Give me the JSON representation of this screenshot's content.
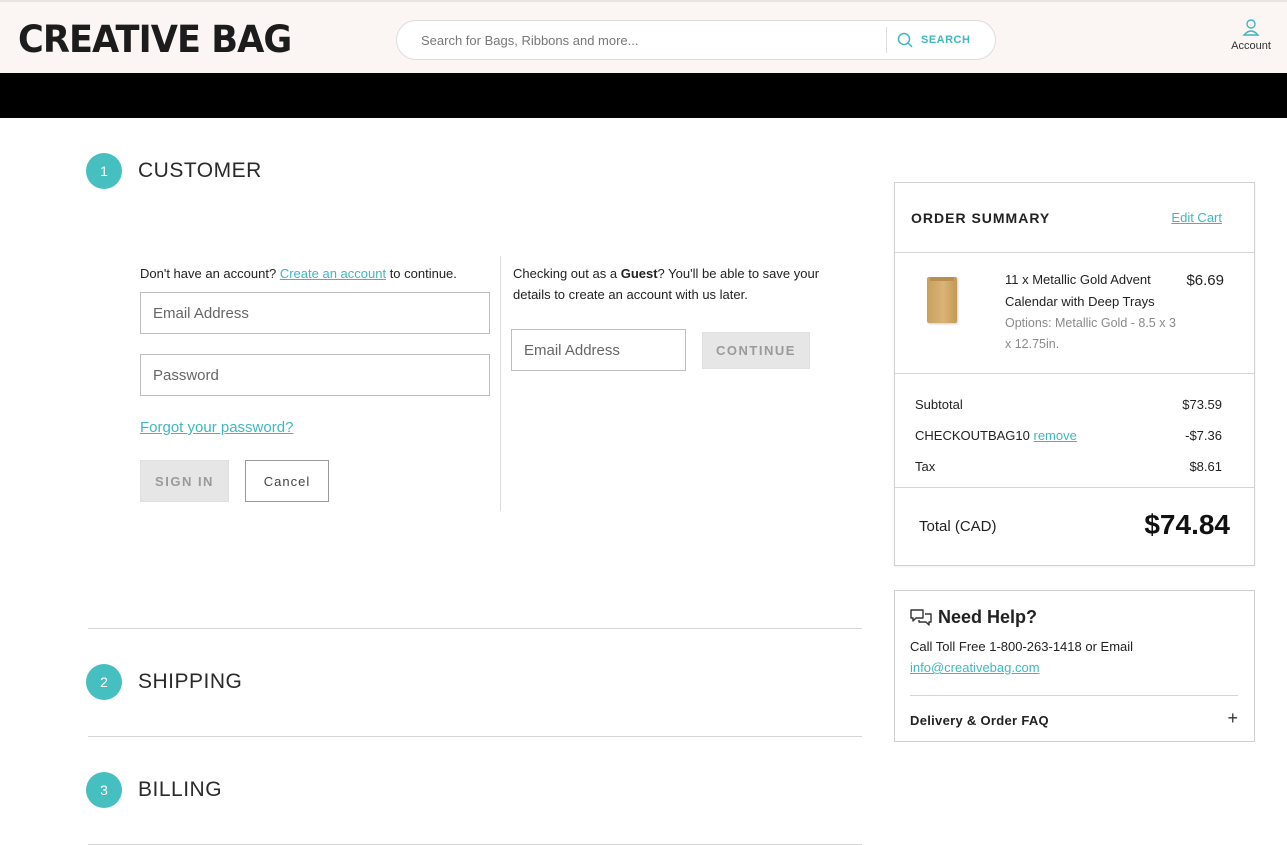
{
  "header": {
    "logo": "CREATIVE BAG",
    "search_placeholder": "Search for Bags, Ribbons and more...",
    "search_button": "SEARCH",
    "account_label": "Account"
  },
  "steps": {
    "customer": {
      "number": "1",
      "title": "CUSTOMER"
    },
    "shipping": {
      "number": "2",
      "title": "SHIPPING"
    },
    "billing": {
      "number": "3",
      "title": "BILLING"
    }
  },
  "login": {
    "prompt_pre": "Don't have an account?",
    "create_link": "Create an account",
    "prompt_post": "to continue.",
    "email_placeholder": "Email Address",
    "password_placeholder": "Password",
    "forgot_link": "Forgot your password?",
    "signin_button": "SIGN IN",
    "cancel_button": "Cancel"
  },
  "guest": {
    "text_pre": "Checking out as a",
    "text_bold": "Guest",
    "text_post": "? You'll be able to save your details to create an account with us later.",
    "email_placeholder": "Email Address",
    "continue_button": "CONTINUE"
  },
  "order_summary": {
    "title": "ORDER SUMMARY",
    "edit_cart": "Edit Cart",
    "item": {
      "name": "11 x Metallic Gold Advent Calendar with Deep Trays",
      "options": "Options: Metallic Gold - 8.5 x 3 x 12.75in.",
      "price": "$6.69",
      "image_icon": "gold-bag-image"
    },
    "subtotal_label": "Subtotal",
    "subtotal_value": "$73.59",
    "coupon_code": "CHECKOUTBAG10",
    "coupon_remove": "remove",
    "coupon_value": "-$7.36",
    "tax_label": "Tax",
    "tax_value": "$8.61",
    "total_label": "Total (CAD)",
    "total_value": "$74.84"
  },
  "help": {
    "title": "Need Help?",
    "text": "Call Toll Free 1-800-263-1418 or Email",
    "email": "info@creativebag.com",
    "faq_label": "Delivery & Order FAQ",
    "faq_toggle": "+"
  },
  "colors": {
    "accent": "#45bfc0",
    "header_bg": "#fbf5f4",
    "band": "#000000"
  }
}
